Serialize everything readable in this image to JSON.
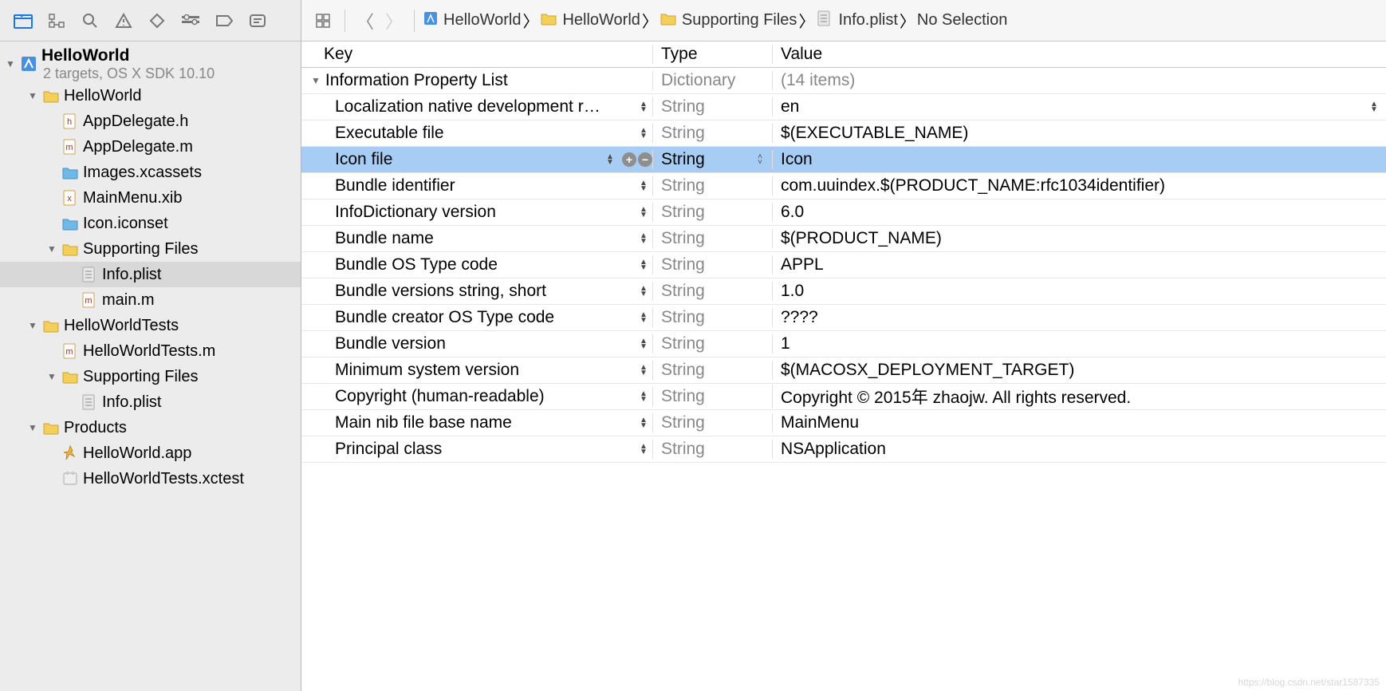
{
  "sidebar": {
    "project": {
      "title": "HelloWorld",
      "subtitle": "2 targets, OS X SDK 10.10"
    },
    "tree": [
      {
        "label": "HelloWorld",
        "kind": "folder",
        "indent": 1,
        "expand": true
      },
      {
        "label": "AppDelegate.h",
        "kind": "h",
        "indent": 2
      },
      {
        "label": "AppDelegate.m",
        "kind": "m",
        "indent": 2
      },
      {
        "label": "Images.xcassets",
        "kind": "assets",
        "indent": 2
      },
      {
        "label": "MainMenu.xib",
        "kind": "xib",
        "indent": 2
      },
      {
        "label": "Icon.iconset",
        "kind": "iconset",
        "indent": 2
      },
      {
        "label": "Supporting Files",
        "kind": "folder",
        "indent": 2,
        "expand": true
      },
      {
        "label": "Info.plist",
        "kind": "plist",
        "indent": 3,
        "selected": true
      },
      {
        "label": "main.m",
        "kind": "m",
        "indent": 3
      },
      {
        "label": "HelloWorldTests",
        "kind": "folder",
        "indent": 1,
        "expand": true
      },
      {
        "label": "HelloWorldTests.m",
        "kind": "m",
        "indent": 2
      },
      {
        "label": "Supporting Files",
        "kind": "folder",
        "indent": 2,
        "expand": true
      },
      {
        "label": "Info.plist",
        "kind": "plist",
        "indent": 3
      },
      {
        "label": "Products",
        "kind": "folder",
        "indent": 1,
        "expand": true
      },
      {
        "label": "HelloWorld.app",
        "kind": "app",
        "indent": 2
      },
      {
        "label": "HelloWorldTests.xctest",
        "kind": "xctest",
        "indent": 2
      }
    ]
  },
  "breadcrumb": [
    {
      "label": "HelloWorld",
      "kind": "project"
    },
    {
      "label": "HelloWorld",
      "kind": "folder"
    },
    {
      "label": "Supporting Files",
      "kind": "folder"
    },
    {
      "label": "Info.plist",
      "kind": "plist"
    },
    {
      "label": "No Selection",
      "kind": "none"
    }
  ],
  "plist": {
    "headers": {
      "key": "Key",
      "type": "Type",
      "value": "Value"
    },
    "root": {
      "key": "Information Property List",
      "type": "Dictionary",
      "value": "(14 items)"
    },
    "rows": [
      {
        "key": "Localization native development r…",
        "type": "String",
        "value": "en",
        "hasValueStepper": true
      },
      {
        "key": "Executable file",
        "type": "String",
        "value": "$(EXECUTABLE_NAME)"
      },
      {
        "key": "Icon file",
        "type": "String",
        "value": "Icon",
        "selected": true,
        "hasTypeStepper": true
      },
      {
        "key": "Bundle identifier",
        "type": "String",
        "value": "com.uuindex.$(PRODUCT_NAME:rfc1034identifier)"
      },
      {
        "key": "InfoDictionary version",
        "type": "String",
        "value": "6.0"
      },
      {
        "key": "Bundle name",
        "type": "String",
        "value": "$(PRODUCT_NAME)"
      },
      {
        "key": "Bundle OS Type code",
        "type": "String",
        "value": "APPL"
      },
      {
        "key": "Bundle versions string, short",
        "type": "String",
        "value": "1.0"
      },
      {
        "key": "Bundle creator OS Type code",
        "type": "String",
        "value": "????"
      },
      {
        "key": "Bundle version",
        "type": "String",
        "value": "1"
      },
      {
        "key": "Minimum system version",
        "type": "String",
        "value": "$(MACOSX_DEPLOYMENT_TARGET)"
      },
      {
        "key": "Copyright (human-readable)",
        "type": "String",
        "value": "Copyright © 2015年 zhaojw. All rights reserved."
      },
      {
        "key": "Main nib file base name",
        "type": "String",
        "value": "MainMenu"
      },
      {
        "key": "Principal class",
        "type": "String",
        "value": "NSApplication"
      }
    ]
  },
  "watermark": "https://blog.csdn.net/star1587335"
}
